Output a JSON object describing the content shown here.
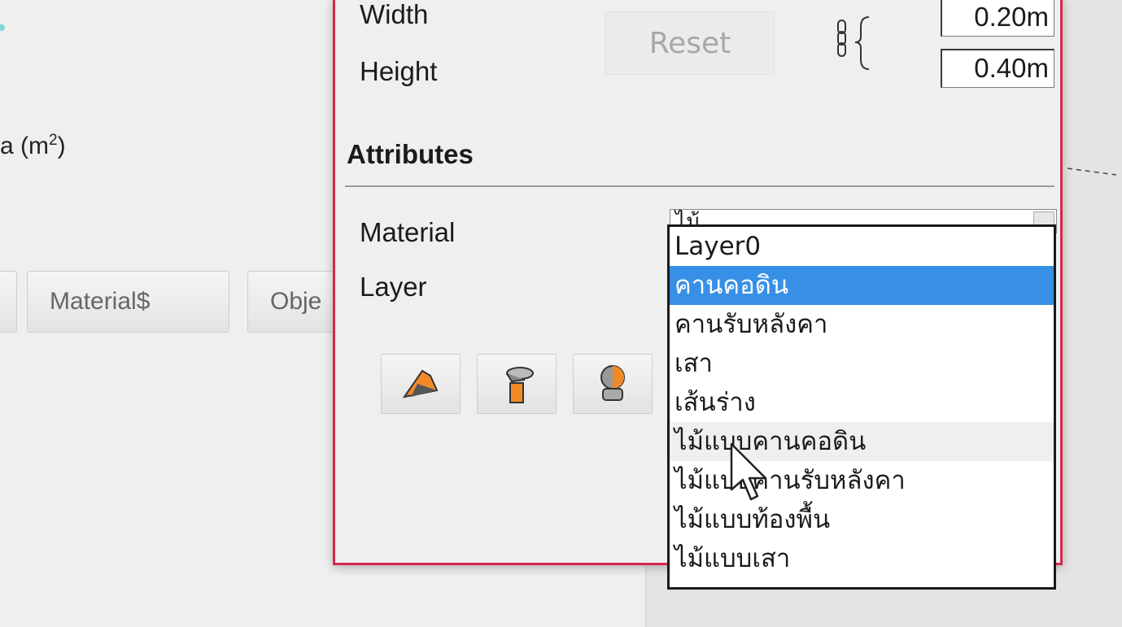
{
  "background": {
    "area_label_prefix": "a (m",
    "area_label_sup": "2",
    "area_label_suffix": ")",
    "tabs": [
      "Material$",
      "Obje"
    ]
  },
  "dialog": {
    "width_label": "Width",
    "height_label": "Height",
    "reset_label": "Reset",
    "width_value": "0.20m",
    "height_value": "0.40m",
    "attributes_heading": "Attributes",
    "material_label": "Material",
    "layer_label": "Layer",
    "material_value": "ไม้",
    "tool_icons": [
      "paint-bucket-icon",
      "sample-paint-icon",
      "layer-tag-icon"
    ]
  },
  "layer_dropdown": {
    "options": [
      "Layer0",
      "คานคอดิน",
      "คานรับหลังคา",
      "เสา",
      "เส้นร่าง",
      "ไม้แบบคานคอดิน",
      "ไม้แบบคานรับหลังคา",
      "ไม้แบบท้องพื้น",
      "ไม้แบบเสา"
    ],
    "selected": "คานคอดิน",
    "hovered": "ไม้แบบคานคอดิน"
  },
  "colors": {
    "dialog_border": "#d8264c",
    "selection": "#3790e6",
    "icon_orange": "#f08a28"
  }
}
